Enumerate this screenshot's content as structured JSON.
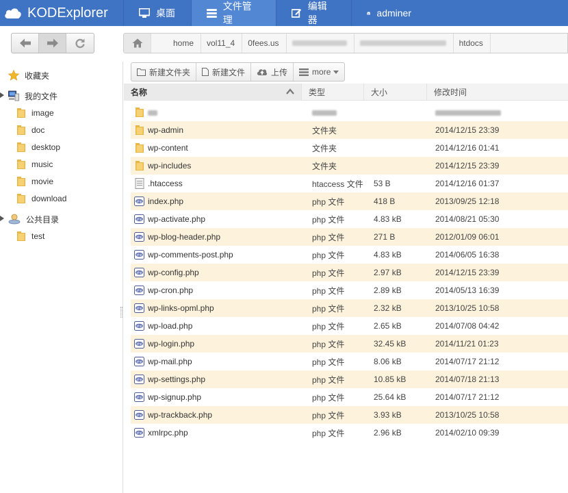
{
  "app": {
    "title": "KODExplorer"
  },
  "nav": [
    {
      "label": "桌面",
      "icon": "monitor-icon"
    },
    {
      "label": "文件管理",
      "icon": "list-icon"
    },
    {
      "label": "编辑器",
      "icon": "edit-icon"
    },
    {
      "label": "adminer",
      "icon": "database-icon"
    }
  ],
  "breadcrumb": [
    "home",
    "vol11_4",
    "0fees.us",
    "htdocs"
  ],
  "sidebar": {
    "favorites": "收藏夹",
    "my_files": "我的文件",
    "folders": [
      "image",
      "doc",
      "desktop",
      "music",
      "movie",
      "download"
    ],
    "public": "公共目录",
    "public_folders": [
      "test"
    ]
  },
  "actions": {
    "new_folder": "新建文件夹",
    "new_file": "新建文件",
    "upload": "上传",
    "more": "more"
  },
  "columns": {
    "name": "名称",
    "type": "类型",
    "size": "大小",
    "mtime": "修改时间"
  },
  "files": [
    {
      "name": "wp-admin",
      "type": "文件夹",
      "size": "",
      "mtime": "2014/12/15 23:39",
      "kind": "folder"
    },
    {
      "name": "wp-content",
      "type": "文件夹",
      "size": "",
      "mtime": "2014/12/16 01:41",
      "kind": "folder"
    },
    {
      "name": "wp-includes",
      "type": "文件夹",
      "size": "",
      "mtime": "2014/12/15 23:39",
      "kind": "folder"
    },
    {
      "name": ".htaccess",
      "type": "htaccess 文件",
      "size": "53 B",
      "mtime": "2014/12/16 01:37",
      "kind": "text"
    },
    {
      "name": "index.php",
      "type": "php 文件",
      "size": "418 B",
      "mtime": "2013/09/25 12:18",
      "kind": "php"
    },
    {
      "name": "wp-activate.php",
      "type": "php 文件",
      "size": "4.83 kB",
      "mtime": "2014/08/21 05:30",
      "kind": "php"
    },
    {
      "name": "wp-blog-header.php",
      "type": "php 文件",
      "size": "271 B",
      "mtime": "2012/01/09 06:01",
      "kind": "php"
    },
    {
      "name": "wp-comments-post.php",
      "type": "php 文件",
      "size": "4.83 kB",
      "mtime": "2014/06/05 16:38",
      "kind": "php"
    },
    {
      "name": "wp-config.php",
      "type": "php 文件",
      "size": "2.97 kB",
      "mtime": "2014/12/15 23:39",
      "kind": "php"
    },
    {
      "name": "wp-cron.php",
      "type": "php 文件",
      "size": "2.89 kB",
      "mtime": "2014/05/13 16:39",
      "kind": "php"
    },
    {
      "name": "wp-links-opml.php",
      "type": "php 文件",
      "size": "2.32 kB",
      "mtime": "2013/10/25 10:58",
      "kind": "php"
    },
    {
      "name": "wp-load.php",
      "type": "php 文件",
      "size": "2.65 kB",
      "mtime": "2014/07/08 04:42",
      "kind": "php"
    },
    {
      "name": "wp-login.php",
      "type": "php 文件",
      "size": "32.45 kB",
      "mtime": "2014/11/21 01:23",
      "kind": "php"
    },
    {
      "name": "wp-mail.php",
      "type": "php 文件",
      "size": "8.06 kB",
      "mtime": "2014/07/17 21:12",
      "kind": "php"
    },
    {
      "name": "wp-settings.php",
      "type": "php 文件",
      "size": "10.85 kB",
      "mtime": "2014/07/18 21:13",
      "kind": "php"
    },
    {
      "name": "wp-signup.php",
      "type": "php 文件",
      "size": "25.64 kB",
      "mtime": "2014/07/17 21:12",
      "kind": "php"
    },
    {
      "name": "wp-trackback.php",
      "type": "php 文件",
      "size": "3.93 kB",
      "mtime": "2013/10/25 10:58",
      "kind": "php"
    },
    {
      "name": "xmlrpc.php",
      "type": "php 文件",
      "size": "2.96 kB",
      "mtime": "2014/02/10 09:39",
      "kind": "php"
    }
  ],
  "colors": {
    "topbar": "#3f73c3",
    "topbar_active": "#5287d4",
    "row_alt": "#fdf3dc"
  }
}
